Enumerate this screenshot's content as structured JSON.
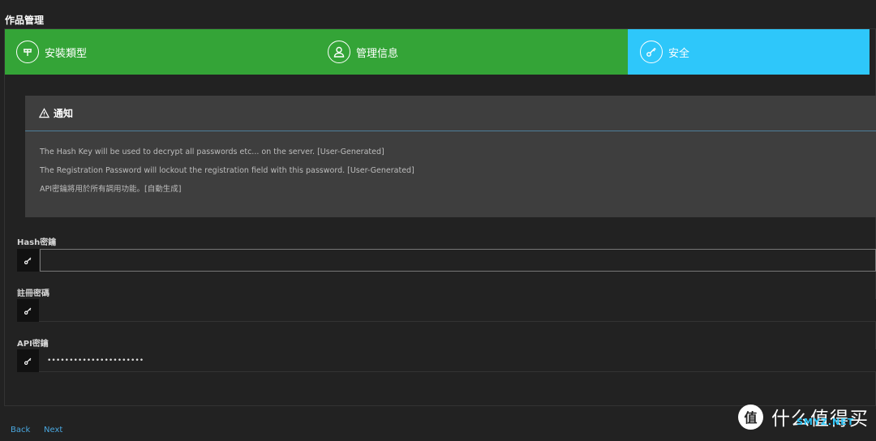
{
  "page": {
    "title": "作品管理"
  },
  "steps": [
    {
      "label": "安裝類型",
      "icon": "steering-icon",
      "state": "done"
    },
    {
      "label": "管理信息",
      "icon": "user-icon",
      "state": "done"
    },
    {
      "label": "安全",
      "icon": "key-icon",
      "state": "active"
    }
  ],
  "colors": {
    "step_done": "#34a437",
    "step_active": "#2ec7fa",
    "link": "#4aa8e0"
  },
  "notice": {
    "title": "通知",
    "lines": [
      "The Hash Key will be used to decrypt all passwords etc... on the server. [User-Generated]",
      "The Registration Password will lockout the registration field with this password. [User-Generated]",
      "API密鑰將用於所有調用功能。[自動生成]"
    ]
  },
  "fields": {
    "hash": {
      "label": "Hash密鑰",
      "value": ""
    },
    "registration": {
      "label": "註冊密碼",
      "value": ""
    },
    "api": {
      "label": "API密鑰",
      "value": "••••••••••••••••••••••"
    }
  },
  "nav": {
    "back": "Back",
    "next": "Next"
  },
  "watermark": {
    "text": "什么值得买",
    "url": "SMYZ.NET"
  }
}
